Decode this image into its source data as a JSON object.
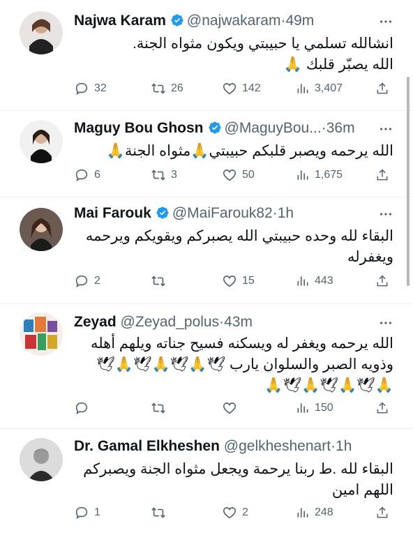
{
  "tweets": [
    {
      "name": "Najwa Karam",
      "handle": "@najwakaram",
      "time": "49m",
      "text_lines": [
        "انشالله تسلمي يا حبيبتي ويكون مثواه الجنة.",
        "الله يصبّر قلبك 🙏"
      ],
      "reply": "32",
      "retweet": "26",
      "like": "142",
      "views": "3,407"
    },
    {
      "name": "Maguy Bou Ghosn",
      "handle": "@MaguyBou...",
      "time": "36m",
      "text_lines": [
        "الله يرحمه ويصبر قلبكم حبيبتي🙏مثواه الجنة🙏"
      ],
      "reply": "6",
      "retweet": "3",
      "like": "50",
      "views": "1,675"
    },
    {
      "name": "Mai Farouk",
      "handle": "@MaiFarouk82",
      "time": "1h",
      "text_lines": [
        "البقاء لله وحده حبيبتي الله يصبركم ويقويكم ويرحمه",
        "ويغفرله"
      ],
      "reply": "2",
      "retweet": "",
      "like": "15",
      "views": "443"
    },
    {
      "name": "Zeyad",
      "handle": "@Zeyad_polus",
      "time": "43m",
      "text_lines": [
        "الله يرحمه ويغفر له ويسكنه فسيح جناته ويلهم أهله",
        "وذويه الصبر والسلوان يارب 🕊🙏🕊🙏🕊🙏🕊",
        "🙏🕊🙏🕊🙏🕊🙏"
      ],
      "reply": "",
      "retweet": "",
      "like": "",
      "views": "150"
    },
    {
      "name": "Dr. Gamal Elkheshen",
      "handle": "@gelkheshenart",
      "time": "1h",
      "text_lines": [
        "البقاء لله .ط ربنا يرحمة ويجعل مثواه الجنة ويصبركم",
        "اللهم امين"
      ],
      "reply": "1",
      "retweet": "",
      "like": "2",
      "views": "248"
    }
  ],
  "separator": "·",
  "colors": {
    "verified": "#1d9bf0",
    "secondary_text": "#536471",
    "divider": "#eff3f4"
  }
}
